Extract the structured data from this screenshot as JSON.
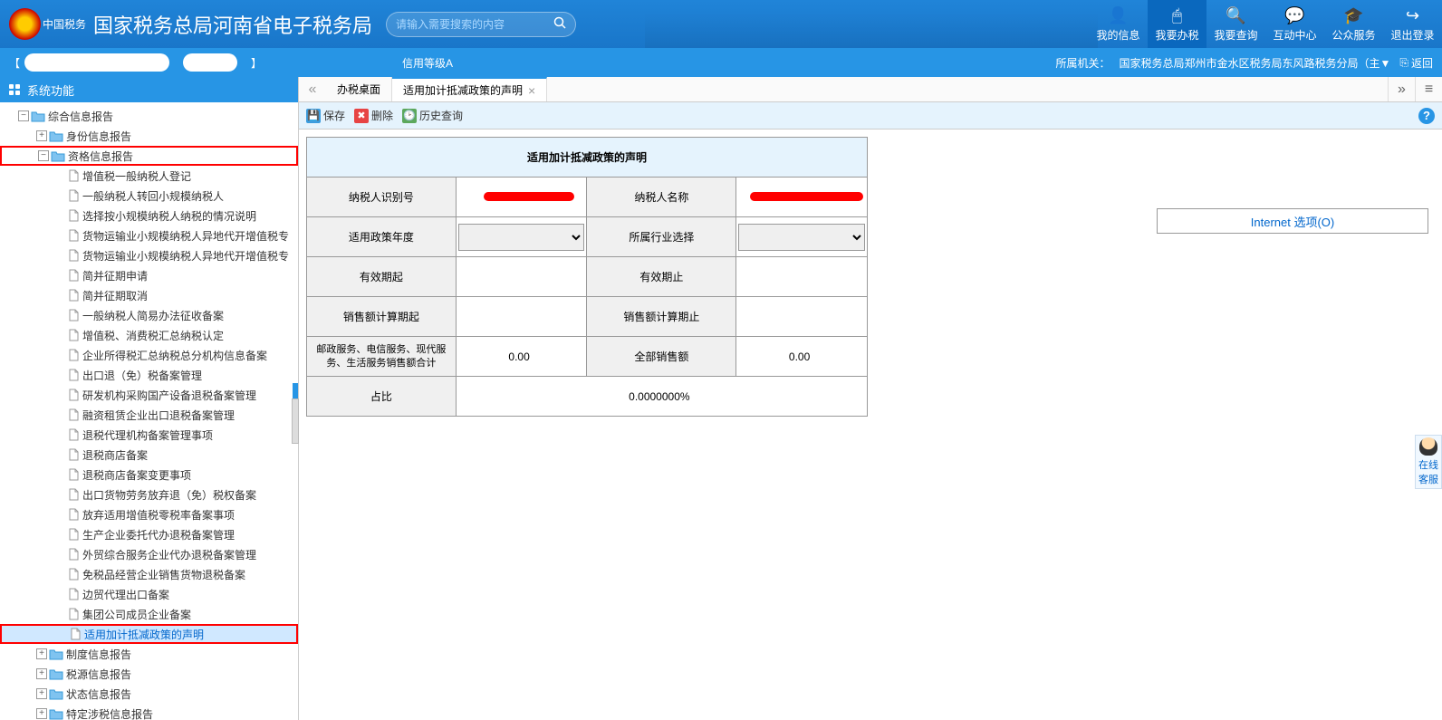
{
  "header": {
    "logo_sub": "中国税务",
    "title": "国家税务总局河南省电子税务局",
    "search_placeholder": "请输入需要搜索的内容",
    "nav": [
      {
        "label": "我的信息",
        "icon": "👤"
      },
      {
        "label": "我要办税",
        "icon": "🖱"
      },
      {
        "label": "我要查询",
        "icon": "🔍"
      },
      {
        "label": "互动中心",
        "icon": "💬"
      },
      {
        "label": "公众服务",
        "icon": "🎓"
      },
      {
        "label": "退出登录",
        "icon": "↪"
      }
    ]
  },
  "sub_header": {
    "credit": "信用等级A",
    "org_label": "所属机关：",
    "org_value": "国家税务总局郑州市金水区税务局东风路税务分局（主▼",
    "return": "返回"
  },
  "sidebar": {
    "title": "系统功能",
    "root": "综合信息报告",
    "folders": [
      "身份信息报告",
      "资格信息报告"
    ],
    "items": [
      "增值税一般纳税人登记",
      "一般纳税人转回小规模纳税人",
      "选择按小规模纳税人纳税的情况说明",
      "货物运输业小规模纳税人异地代开增值税专",
      "货物运输业小规模纳税人异地代开增值税专",
      "简并征期申请",
      "简并征期取消",
      "一般纳税人简易办法征收备案",
      "增值税、消费税汇总纳税认定",
      "企业所得税汇总纳税总分机构信息备案",
      "出口退（免）税备案管理",
      "研发机构采购国产设备退税备案管理",
      "融资租赁企业出口退税备案管理",
      "退税代理机构备案管理事项",
      "退税商店备案",
      "退税商店备案变更事项",
      "出口货物劳务放弃退（免）税权备案",
      "放弃适用增值税零税率备案事项",
      "生产企业委托代办退税备案管理",
      "外贸综合服务企业代办退税备案管理",
      "免税品经营企业销售货物退税备案",
      "边贸代理出口备案",
      "集团公司成员企业备案",
      "适用加计抵减政策的声明"
    ],
    "bottom_folders": [
      "制度信息报告",
      "税源信息报告",
      "状态信息报告",
      "特定涉税信息报告"
    ]
  },
  "tabs": {
    "tab1": "办税桌面",
    "tab2": "适用加计抵减政策的声明"
  },
  "toolbar": {
    "save": "保存",
    "delete": "删除",
    "history": "历史查询"
  },
  "form": {
    "title": "适用加计抵减政策的声明",
    "taxpayer_id_label": "纳税人识别号",
    "taxpayer_name_label": "纳税人名称",
    "policy_year_label": "适用政策年度",
    "industry_label": "所属行业选择",
    "valid_from_label": "有效期起",
    "valid_to_label": "有效期止",
    "sales_period_from_label": "销售额计算期起",
    "sales_period_to_label": "销售额计算期止",
    "service_sales_label": "邮政服务、电信服务、现代服务、生活服务销售额合计",
    "service_sales_value": "0.00",
    "total_sales_label": "全部销售额",
    "total_sales_value": "0.00",
    "ratio_label": "占比",
    "ratio_value": "0.0000000%"
  },
  "internet_options": "Internet 选项(O)",
  "float_service": "在线客服"
}
